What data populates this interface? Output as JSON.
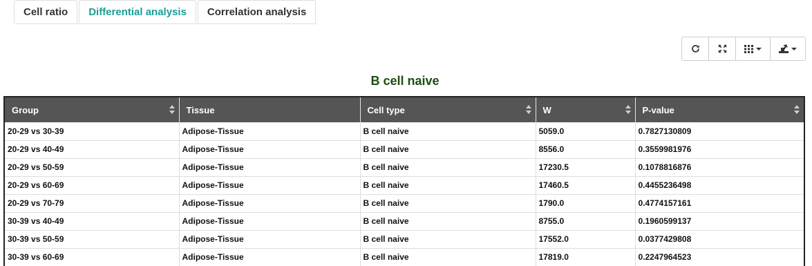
{
  "tabs": [
    {
      "label": "Cell ratio",
      "active": false
    },
    {
      "label": "Differential analysis",
      "active": true
    },
    {
      "label": "Correlation analysis",
      "active": false
    }
  ],
  "toolbar": {
    "buttons": [
      {
        "icon": "refresh-icon"
      },
      {
        "icon": "fullscreen-icon"
      },
      {
        "icon": "columns-icon",
        "dropdown": true
      },
      {
        "icon": "export-icon",
        "dropdown": true
      }
    ]
  },
  "title": "B cell naive",
  "colors": {
    "accent": "#1a9e94",
    "title": "#1e4d0f",
    "header_bg": "#555555"
  },
  "table": {
    "headers": [
      "Group",
      "Tissue",
      "Cell type",
      "W",
      "P-value"
    ],
    "rows": [
      [
        "20-29 vs 30-39",
        "Adipose-Tissue",
        "B cell naive",
        "5059.0",
        "0.7827130809"
      ],
      [
        "20-29 vs 40-49",
        "Adipose-Tissue",
        "B cell naive",
        "8556.0",
        "0.3559981976"
      ],
      [
        "20-29 vs 50-59",
        "Adipose-Tissue",
        "B cell naive",
        "17230.5",
        "0.1078816876"
      ],
      [
        "20-29 vs 60-69",
        "Adipose-Tissue",
        "B cell naive",
        "17460.5",
        "0.4455236498"
      ],
      [
        "20-29 vs 70-79",
        "Adipose-Tissue",
        "B cell naive",
        "1790.0",
        "0.4774157161"
      ],
      [
        "30-39 vs 40-49",
        "Adipose-Tissue",
        "B cell naive",
        "8755.0",
        "0.1960599137"
      ],
      [
        "30-39 vs 50-59",
        "Adipose-Tissue",
        "B cell naive",
        "17552.0",
        "0.0377429808"
      ],
      [
        "30-39 vs 60-69",
        "Adipose-Tissue",
        "B cell naive",
        "17819.0",
        "0.2247964523"
      ]
    ]
  }
}
